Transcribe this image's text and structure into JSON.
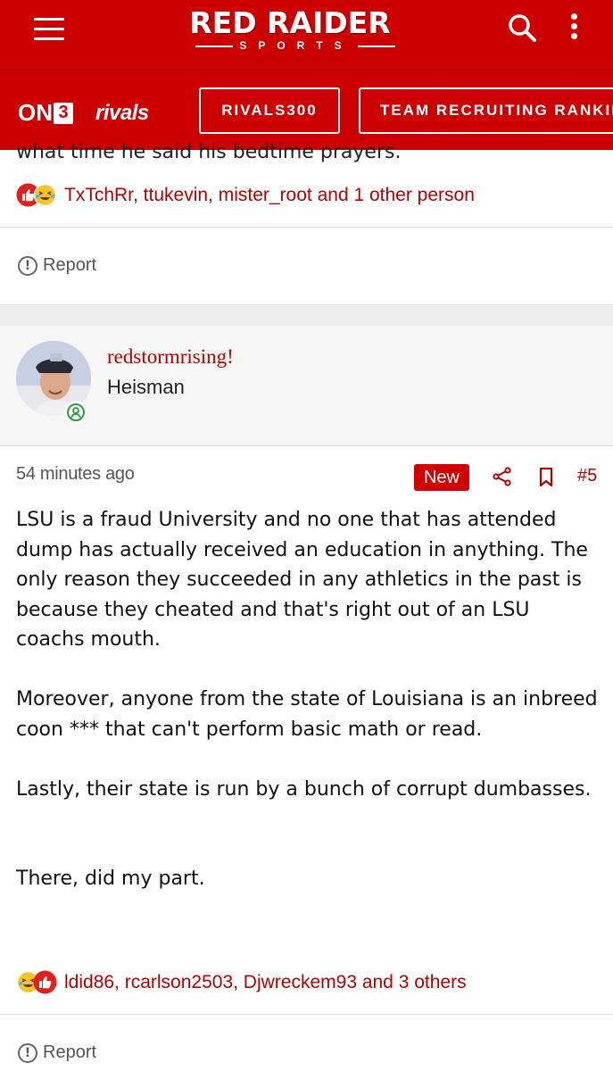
{
  "header": {
    "logo_main": "RED RAIDER",
    "logo_sub": "SPORTS"
  },
  "nav": {
    "on3_label": "ON",
    "on3_number": "3",
    "rivals_label": "rivals",
    "pills": [
      "RIVALS300",
      "TEAM RECRUITING RANKIN"
    ]
  },
  "prev_post": {
    "cut_text": "what time he said his bedtime prayers.",
    "reactions_text": "TxTchRr, ttukevin, mister_root and 1 other person",
    "report_label": "Report"
  },
  "post": {
    "author": {
      "username": "redstormrising!",
      "title": "Heisman"
    },
    "time": "54 minutes ago",
    "badge": "New",
    "number": "#5",
    "paragraphs": [
      "LSU is a fraud University and no one that has attended dump has actually received an education in anything. The only reason they succeeded in any athletics in the past is because they cheated and that's right out of an LSU coachs mouth.",
      "Moreover, anyone from the state of Louisiana is an inbreed coon *** that can't perform basic math or read.",
      "Lastly, their state is run by a bunch of corrupt dumbasses.",
      "There, did my part."
    ],
    "reactions_text": "ldid86, rcarlson2503, Djwreckem93 and 3 others",
    "report_label": "Report"
  },
  "colors": {
    "brand_red": "#cc0000",
    "link_red": "#b30000",
    "online_green": "#2e9e3a"
  },
  "icons": [
    "menu-icon",
    "search-icon",
    "more-vertical-icon",
    "thumbs-up-icon",
    "laugh-cry-icon",
    "report-icon",
    "share-icon",
    "bookmark-icon",
    "online-status-icon"
  ]
}
